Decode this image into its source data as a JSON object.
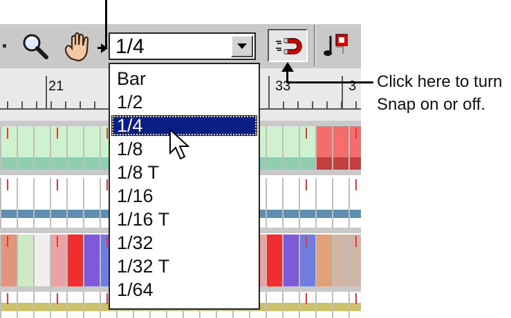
{
  "toolbar": {
    "icons": [
      "magnifier-icon",
      "hand-icon",
      "snap-magnet-icon",
      "note-icon"
    ]
  },
  "quantize": {
    "selected": "1/4",
    "options": [
      "Bar",
      "1/2",
      "1/4",
      "1/8",
      "1/8 T",
      "1/16",
      "1/16 T",
      "1/32",
      "1/32 T",
      "1/64"
    ],
    "highlighted_index": 2
  },
  "ruler": {
    "numbers": [
      "21",
      "33",
      "3"
    ]
  },
  "annotation": {
    "line1": "Click here to turn",
    "line2": "Snap on or off."
  },
  "colors": {
    "selection": "#0a1f86",
    "toolbar": "#c9c9c9"
  }
}
